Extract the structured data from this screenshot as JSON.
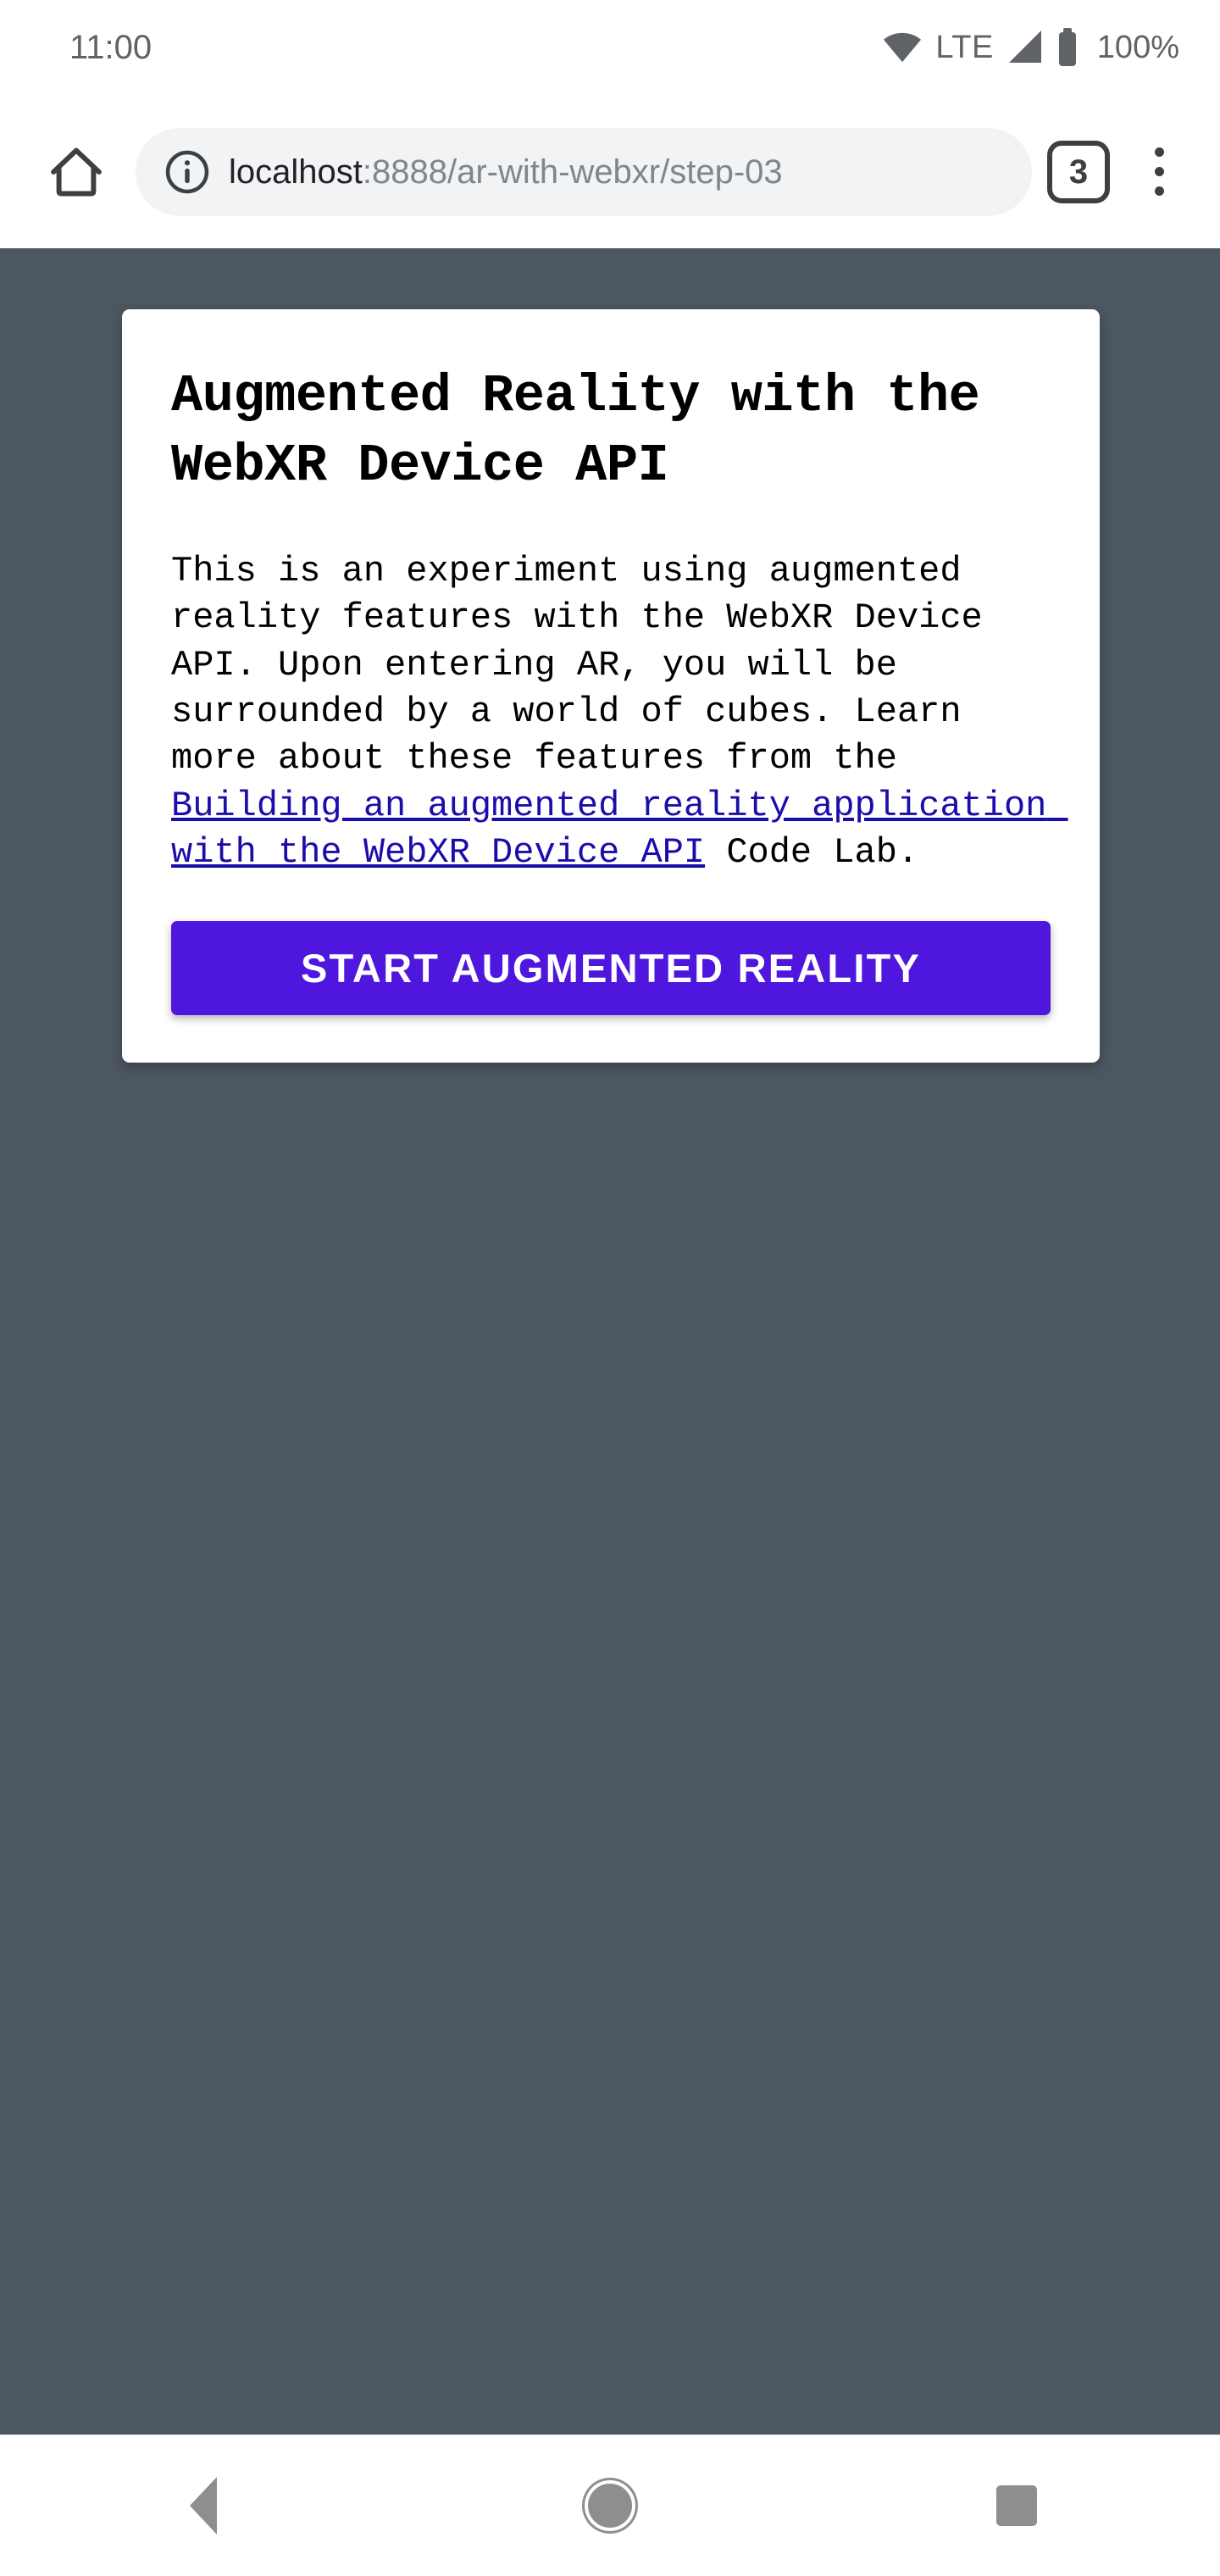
{
  "status_bar": {
    "time": "11:00",
    "network_label": "LTE",
    "battery_percent": "100%",
    "icons": [
      "wifi-icon",
      "signal-icon",
      "battery-icon"
    ]
  },
  "browser": {
    "home_icon": "home-icon",
    "site_info_icon": "info-icon",
    "url_host": "localhost",
    "url_rest": ":8888/ar-with-webxr/step-03",
    "url_full": "localhost:8888/ar-with-webxr/step-03",
    "tab_count": "3",
    "menu_icon": "overflow-menu-icon"
  },
  "page": {
    "background_color": "#4c5762",
    "card": {
      "title": "Augmented Reality with the WebXR Device API",
      "body_before_link": "This is an experiment using augmented reality features with the WebXR Device API. Upon entering AR, you will be surrounded by a world of cubes. Learn more about these features from the ",
      "link_text": "Building an augmented reality application with the WebXR Device API",
      "body_after_link": " Code Lab.",
      "link_color": "#1a0dab",
      "button_label": "START AUGMENTED REALITY",
      "button_color": "#4f16de"
    }
  },
  "navigation_bar": {
    "back_label": "Back",
    "home_label": "Home",
    "recents_label": "Recents"
  }
}
